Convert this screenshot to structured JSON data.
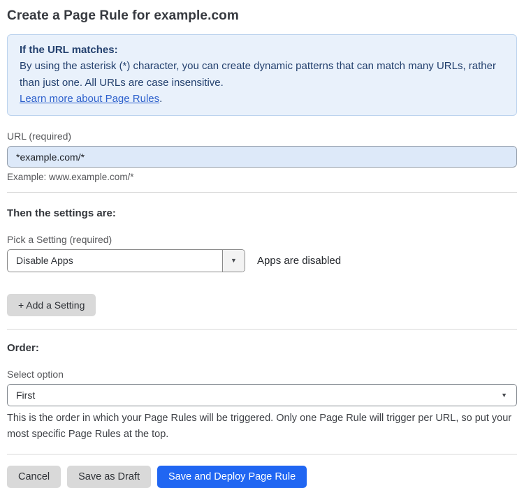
{
  "page": {
    "title": "Create a Page Rule for example.com"
  },
  "info_box": {
    "heading": "If the URL matches:",
    "body": "By using the asterisk (*) character, you can create dynamic patterns that can match many URLs, rather than just one. All URLs are case insensitive.",
    "link": "Learn more about Page Rules",
    "link_suffix": "."
  },
  "url_field": {
    "label": "URL (required)",
    "value": "*example.com/*",
    "hint": "Example: www.example.com/*"
  },
  "settings_section": {
    "heading": "Then the settings are:",
    "picker_label": "Pick a Setting (required)",
    "selected_setting": "Disable Apps",
    "status_text": "Apps are disabled",
    "add_button_label": "+ Add a Setting"
  },
  "order_section": {
    "heading": "Order:",
    "select_label": "Select option",
    "selected_option": "First",
    "help_text": "This is the order in which your Page Rules will be triggered. Only one Page Rule will trigger per URL, so put your most specific Page Rules at the top."
  },
  "footer": {
    "cancel_label": "Cancel",
    "save_draft_label": "Save as Draft",
    "save_deploy_label": "Save and Deploy Page Rule"
  },
  "icons": {
    "dropdown_caret": "▼"
  },
  "colors": {
    "accent_blue": "#2066f2",
    "info_box_bg": "#e9f1fb",
    "info_box_border": "#bcd3ee",
    "info_text": "#23406e",
    "link_blue": "#2b5fcc",
    "url_input_bg": "#dde9f9",
    "gray_button_bg": "#d9d9d9"
  }
}
